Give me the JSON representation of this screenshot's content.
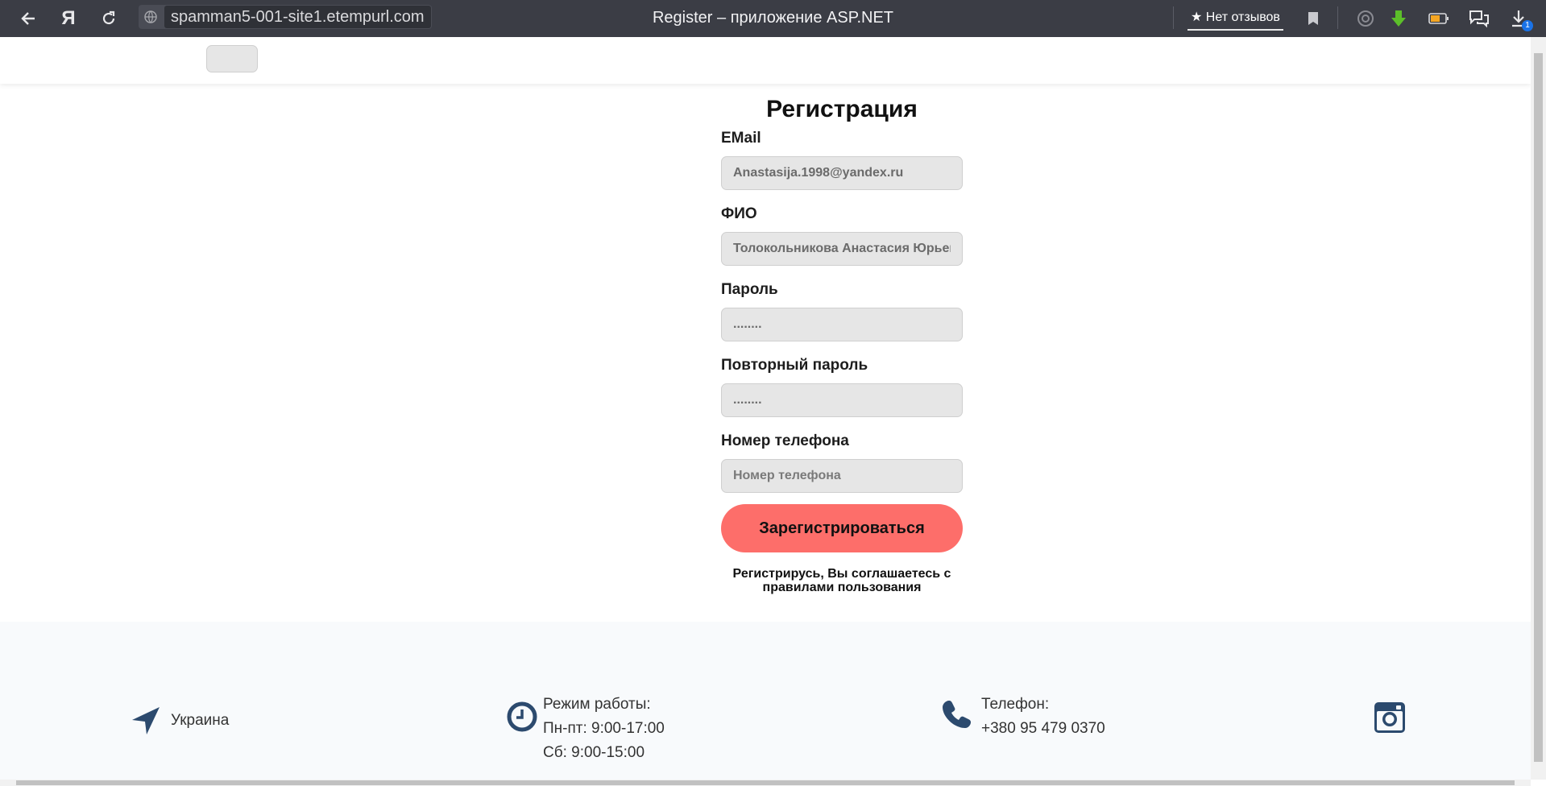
{
  "browser": {
    "url": "spamman5-001-site1.etempurl.com",
    "tab_title": "Register – приложение ASP.NET",
    "reviews_label": "★ Нет отзывов",
    "download_badge": "1"
  },
  "form": {
    "title": "Регистрация",
    "email_label": "EMail",
    "email_value": "Anastasija.1998@yandex.ru",
    "fio_label": "ФИО",
    "fio_value": "Толокольникова Анастасия Юрьевна",
    "password_label": "Пароль",
    "password_value": "........",
    "repeat_password_label": "Повторный пароль",
    "repeat_password_value": "........",
    "phone_label": "Номер телефона",
    "phone_placeholder": "Номер телефона",
    "submit_label": "Зарегистрироваться",
    "terms_text": "Регистрирусь, Вы соглашаетесь с правилами пользования"
  },
  "footer": {
    "location": "Украина",
    "hours_title": "Режим работы:",
    "hours_weekdays": "Пн-пт: 9:00-17:00",
    "hours_saturday": "Сб: 9:00-15:00",
    "phone_title": "Телефон:",
    "phone_number": "+380 95 479 0370"
  },
  "colors": {
    "chrome": "#3b3d45",
    "accent_button": "#fd6e6a",
    "footer_icon": "#2c4a6e",
    "footer_bg": "#f8fafc"
  },
  "icons": [
    "back-icon",
    "yandex-logo-icon",
    "reload-icon",
    "site-info-icon",
    "bookmark-icon",
    "alice-icon",
    "download-arrow-icon",
    "battery-icon",
    "chat-icon",
    "downloads-icon",
    "location-arrow-icon",
    "clock-icon",
    "phone-icon",
    "instagram-icon"
  ]
}
